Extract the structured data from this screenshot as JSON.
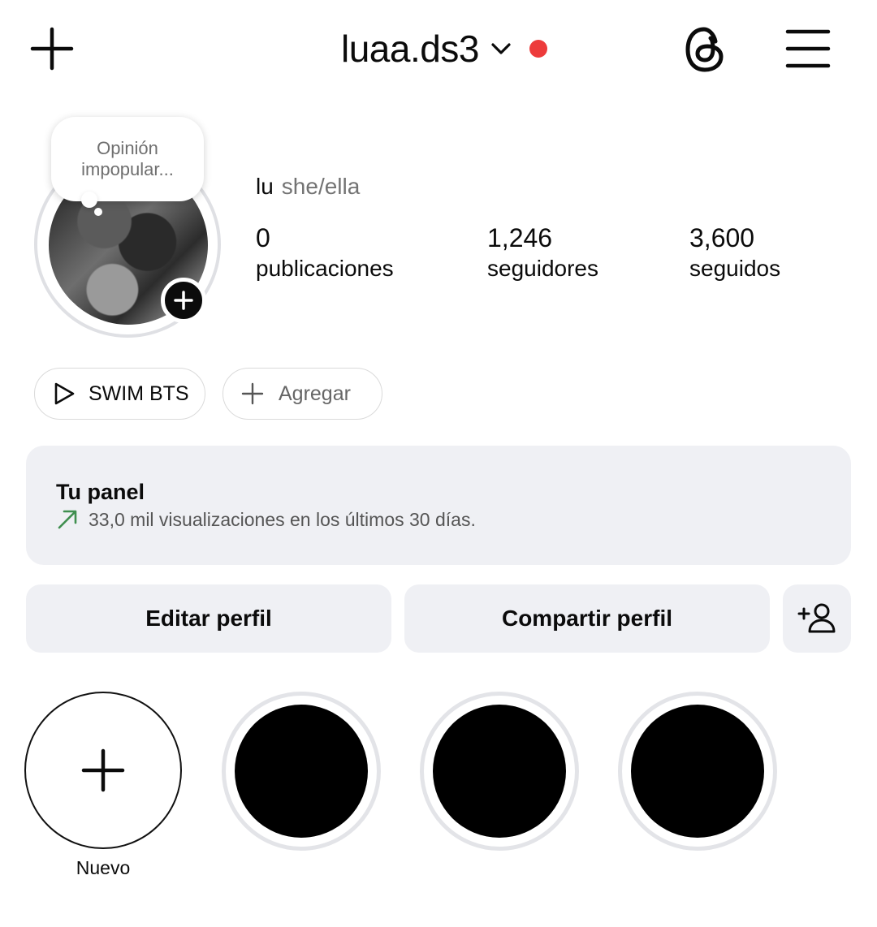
{
  "header": {
    "username": "luaa.ds3",
    "icons": {
      "new_post": "plus-icon",
      "switch_account": "chevron-down-icon",
      "threads": "threads-icon",
      "menu": "hamburger-menu-icon"
    },
    "notification_dot_color": "#ed3b3b"
  },
  "profile": {
    "note": "Opinión impopular...",
    "name": "lu",
    "pronouns": "she/ella",
    "stats": [
      {
        "value": "0",
        "label": "publicaciones"
      },
      {
        "value": "1,246",
        "label": "seguidores"
      },
      {
        "value": "3,600",
        "label": "seguidos"
      }
    ]
  },
  "chips": {
    "reel_label": "SWIM BTS",
    "add_label": "Agregar"
  },
  "panel": {
    "title": "Tu panel",
    "subtitle": "33,0 mil visualizaciones en los últimos 30 días.",
    "trend_color": "#3f8f4f"
  },
  "buttons": {
    "edit": "Editar perfil",
    "share": "Compartir perfil"
  },
  "highlights": {
    "new_label": "Nuevo",
    "count_existing": 3
  }
}
